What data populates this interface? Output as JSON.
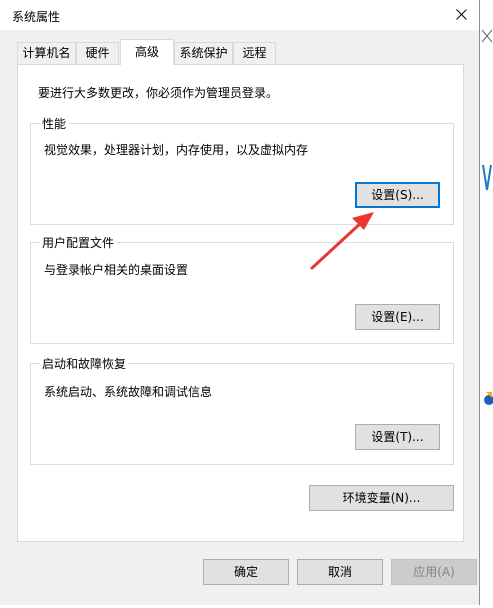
{
  "window": {
    "title": "系统属性"
  },
  "tabs": [
    {
      "label": "计算机名"
    },
    {
      "label": "硬件"
    },
    {
      "label": "高级"
    },
    {
      "label": "系统保护"
    },
    {
      "label": "远程"
    }
  ],
  "active_tab": "高级",
  "notice": "要进行大多数更改，你必须作为管理员登录。",
  "groups": {
    "performance": {
      "title": "性能",
      "description": "视觉效果，处理器计划，内存使用，以及虚拟内存",
      "button": "设置(S)..."
    },
    "user_profiles": {
      "title": "用户配置文件",
      "description": "与登录帐户相关的桌面设置",
      "button": "设置(E)..."
    },
    "startup_recovery": {
      "title": "启动和故障恢复",
      "description": "系统启动、系统故障和调试信息",
      "button": "设置(T)..."
    }
  },
  "env_button": "环境变量(N)...",
  "footer": {
    "ok": "确定",
    "cancel": "取消",
    "apply": "应用(A)"
  },
  "colors": {
    "accent": "#0078d7",
    "arrow": "#e8372f",
    "dialog_bg": "#f0f0f0"
  },
  "icons": [
    "close-icon",
    "arrow-annotation-icon"
  ]
}
